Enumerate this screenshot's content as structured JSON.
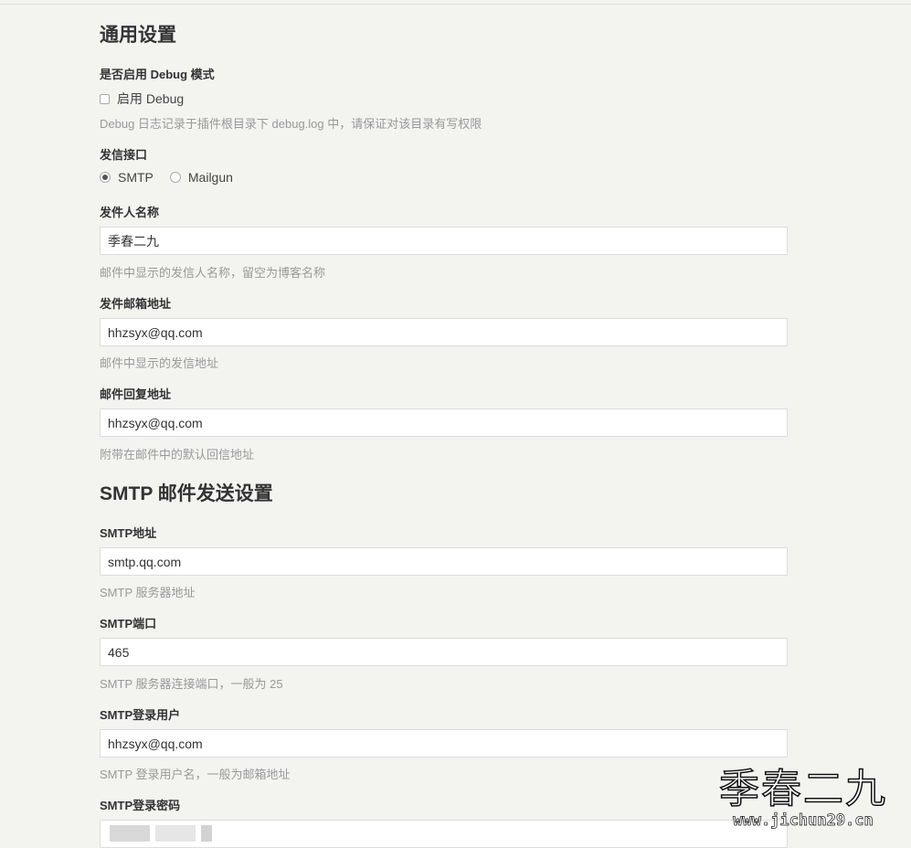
{
  "general": {
    "title": "通用设置",
    "debug": {
      "label": "是否启用 Debug 模式",
      "checkbox_label": "启用 Debug",
      "checked": false,
      "help": "Debug 日志记录于插件根目录下 debug.log 中，请保证对该目录有写权限"
    },
    "mailer": {
      "label": "发信接口",
      "options": [
        "SMTP",
        "Mailgun"
      ],
      "selected": "SMTP"
    },
    "from_name": {
      "label": "发件人名称",
      "value": "季春二九",
      "help": "邮件中显示的发信人名称，留空为博客名称"
    },
    "from_email": {
      "label": "发件邮箱地址",
      "value": "hhzsyx@qq.com",
      "help": "邮件中显示的发信地址"
    },
    "reply_to": {
      "label": "邮件回复地址",
      "value": "hhzsyx@qq.com",
      "help": "附带在邮件中的默认回信地址"
    }
  },
  "smtp": {
    "title": "SMTP 邮件发送设置",
    "host": {
      "label": "SMTP地址",
      "value": "smtp.qq.com",
      "help": "SMTP 服务器地址"
    },
    "port": {
      "label": "SMTP端口",
      "value": "465",
      "help": "SMTP 服务器连接端口，一般为 25"
    },
    "user": {
      "label": "SMTP登录用户",
      "value": "hhzsyx@qq.com",
      "help": "SMTP 登录用户名，一般为邮箱地址"
    },
    "password": {
      "label": "SMTP登录密码"
    }
  },
  "watermark": {
    "text": "季春二九",
    "url": "www.jichun29.cn"
  }
}
